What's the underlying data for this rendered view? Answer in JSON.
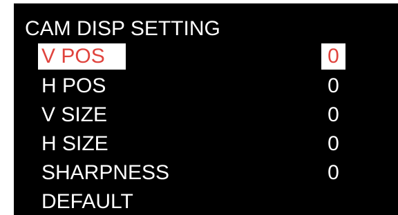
{
  "menu": {
    "title": "CAM DISP SETTING",
    "items": [
      {
        "label": "V POS",
        "value": "0",
        "selected": true
      },
      {
        "label": "H POS",
        "value": "0",
        "selected": false
      },
      {
        "label": "V SIZE",
        "value": "0",
        "selected": false
      },
      {
        "label": "H SIZE",
        "value": "0",
        "selected": false
      },
      {
        "label": "SHARPNESS",
        "value": "0",
        "selected": false
      },
      {
        "label": "DEFAULT",
        "selected": false
      }
    ]
  },
  "colors": {
    "background": "#000000",
    "text": "#ffffff",
    "highlight_bg": "#ffffff",
    "highlight_text": "#e0443e"
  }
}
